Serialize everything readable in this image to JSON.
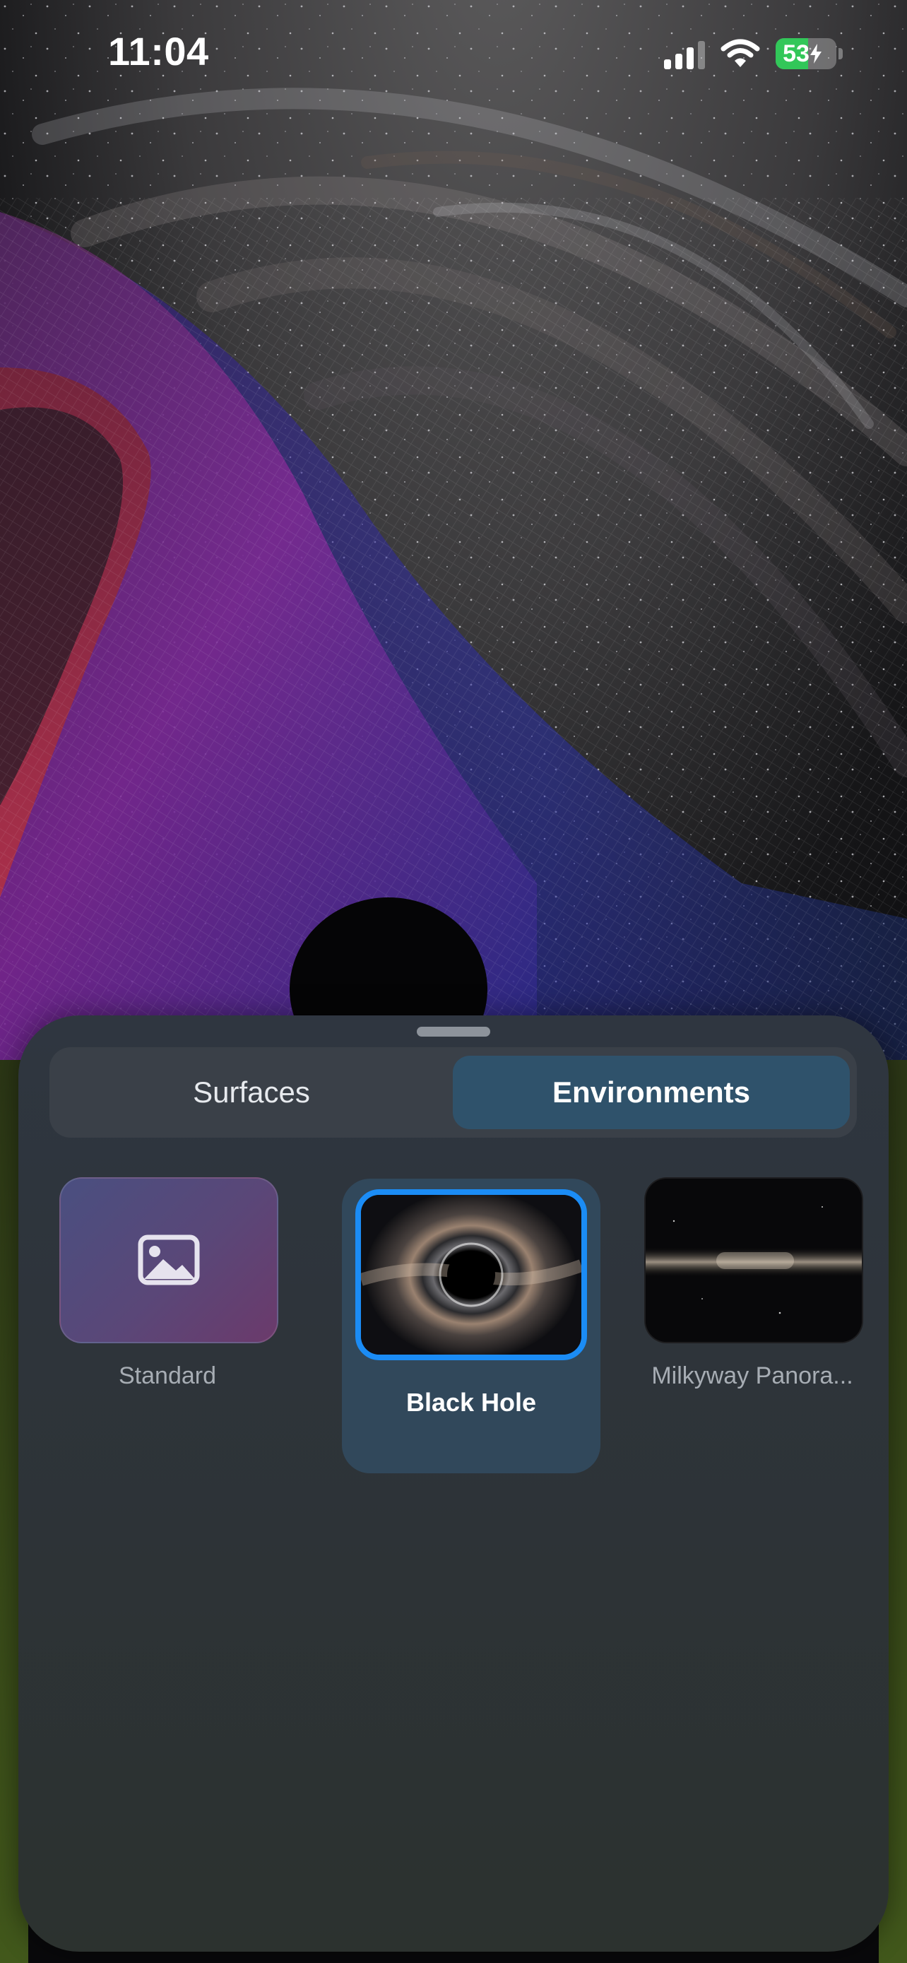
{
  "status_bar": {
    "time": "11:04",
    "battery_percent": "53",
    "battery_level": 0.53,
    "charging": true,
    "signal_bars": 3,
    "icons": [
      "cellular-signal-icon",
      "wifi-icon",
      "battery-charging-icon"
    ]
  },
  "sheet": {
    "tabs": [
      {
        "label": "Surfaces",
        "selected": false
      },
      {
        "label": "Environments",
        "selected": true
      }
    ],
    "environments": [
      {
        "label": "Standard",
        "icon": "photo-icon",
        "selected": false
      },
      {
        "label": "Black Hole",
        "selected": true
      },
      {
        "label": "Milkyway Panora...",
        "selected": false
      }
    ]
  },
  "colors": {
    "accent_selection": "#1b8cf5",
    "selected_tab": "#2f526b",
    "battery_green": "#32c759"
  }
}
